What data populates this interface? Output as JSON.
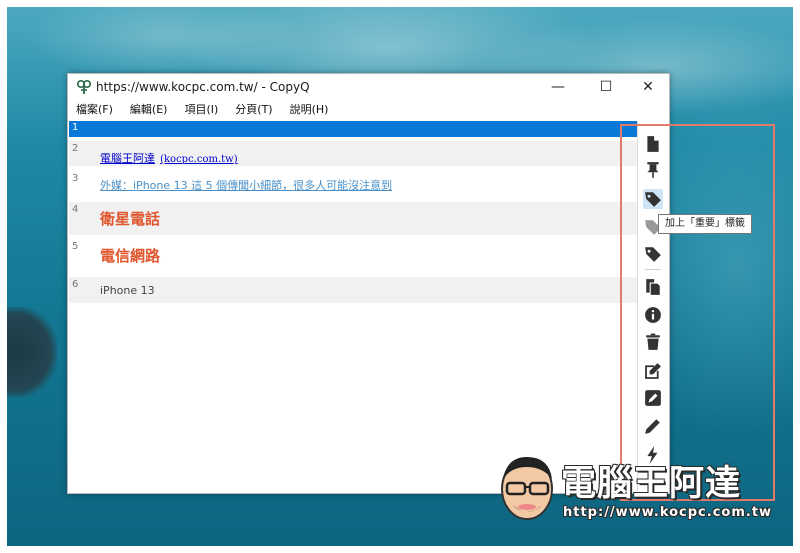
{
  "window": {
    "title": "https://www.kocpc.com.tw/ - CopyQ",
    "minimize_glyph": "—",
    "maximize_glyph": "☐",
    "close_glyph": "✕"
  },
  "menubar": {
    "items": [
      {
        "label": "檔案(F)"
      },
      {
        "label": "編輯(E)"
      },
      {
        "label": "項目(I)"
      },
      {
        "label": "分頁(T)"
      },
      {
        "label": "說明(H)"
      }
    ]
  },
  "clipboard_items": [
    {
      "num": "1",
      "text": ""
    },
    {
      "num": "2",
      "text": "電腦王阿達",
      "link_suffix": "(kocpc.com.tw)"
    },
    {
      "num": "3",
      "text": "外媒：iPhone 13 這 5 個傳聞小細節，很多人可能沒注意到"
    },
    {
      "num": "4",
      "text": "衛星電話"
    },
    {
      "num": "5",
      "text": "電信網路"
    },
    {
      "num": "6",
      "text": "iPhone 13"
    }
  ],
  "toolbar": {
    "icons": [
      "new-item-icon",
      "pin-icon",
      "tag-important-icon",
      "tag-icon",
      "tag-icon",
      "copy-icon",
      "info-icon",
      "delete-icon",
      "edit-icon",
      "edit-external-icon",
      "pencil-icon",
      "action-icon"
    ],
    "tooltip": "加上「重要」標籤"
  },
  "watermark": {
    "title": "電腦王阿達",
    "url": "http://www.kocpc.com.tw"
  },
  "colors": {
    "selection": "#0a78d7",
    "highlight_box": "#e07a6a",
    "big_text": "#e0562e"
  }
}
